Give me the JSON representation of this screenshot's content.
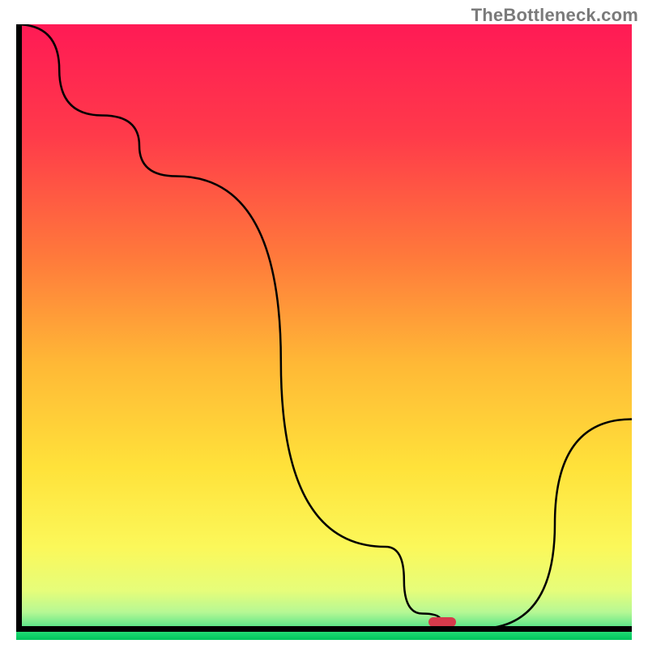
{
  "watermark": "TheBottleneck.com",
  "chart_data": {
    "type": "line",
    "title": "",
    "xlabel": "",
    "ylabel": "",
    "xlim": [
      0,
      100
    ],
    "ylim": [
      0,
      100
    ],
    "x": [
      0,
      14,
      26,
      60,
      66,
      72,
      75,
      100
    ],
    "values": [
      100,
      85,
      75,
      14,
      3,
      0.5,
      0.5,
      35
    ],
    "marker": {
      "x_start": 67,
      "x_end": 71.5,
      "y": 0.5
    },
    "gradient_stops": [
      {
        "pos": 0.0,
        "color": "#ff1a55"
      },
      {
        "pos": 0.18,
        "color": "#ff3a4a"
      },
      {
        "pos": 0.38,
        "color": "#ff7a3b"
      },
      {
        "pos": 0.55,
        "color": "#ffb836"
      },
      {
        "pos": 0.72,
        "color": "#ffe23a"
      },
      {
        "pos": 0.85,
        "color": "#fbf85a"
      },
      {
        "pos": 0.92,
        "color": "#e6fd7a"
      },
      {
        "pos": 0.955,
        "color": "#b6f894"
      },
      {
        "pos": 0.975,
        "color": "#6be88b"
      },
      {
        "pos": 0.99,
        "color": "#17d66e"
      },
      {
        "pos": 1.0,
        "color": "#00c45d"
      }
    ]
  }
}
